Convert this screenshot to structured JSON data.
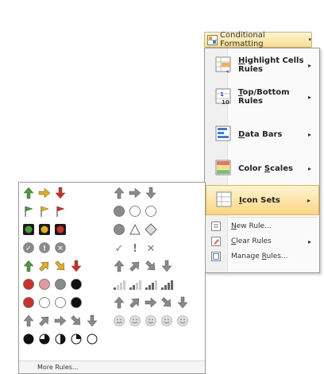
{
  "ribbon": {
    "label": "Conditional Formatting",
    "caret": "▾"
  },
  "menu": {
    "items": [
      {
        "label": "Highlight Cells Rules",
        "accel": "H",
        "rest": "ighlight Cells Rules",
        "icon": "highlight-cells-icon",
        "submenu": true
      },
      {
        "label": "Top/Bottom Rules",
        "accel": "T",
        "rest": "op/Bottom Rules",
        "icon": "top-bottom-icon",
        "submenu": true
      },
      {
        "label": "Data Bars",
        "accel": "D",
        "rest": "ata Bars",
        "icon": "data-bars-icon",
        "submenu": true
      },
      {
        "label": "Color Scales",
        "pre": "Color ",
        "accel": "S",
        "rest": "cales",
        "icon": "color-scales-icon",
        "submenu": true
      },
      {
        "label": "Icon Sets",
        "accel": "I",
        "rest": "con Sets",
        "icon": "icon-sets-icon",
        "submenu": true,
        "hover": true
      }
    ],
    "small_items": [
      {
        "label": "New Rule...",
        "accel": "N",
        "rest": "ew Rule...",
        "icon": "new-rule-icon",
        "submenu": false
      },
      {
        "label": "Clear Rules",
        "accel": "C",
        "rest": "lear Rules",
        "icon": "clear-rules-icon",
        "submenu": true
      },
      {
        "label": "Manage Rules...",
        "pre": "Manage ",
        "accel": "R",
        "rest": "ules...",
        "icon": "manage-rules-icon",
        "submenu": false
      }
    ]
  },
  "gallery": {
    "more_rules": "More Rules...",
    "left_sets": [
      [
        "arrow-up-green",
        "arrow-right-yellow",
        "arrow-down-red"
      ],
      [
        "flag-green",
        "flag-yellow",
        "flag-red"
      ],
      [
        "light-black-green",
        "light-black-yellow",
        "light-black-red"
      ],
      [
        "symbol-check-circle",
        "symbol-excl-circle",
        "symbol-x-circle"
      ],
      [
        "arrow-up-green",
        "arrow-ne-yellow",
        "arrow-se-yellow",
        "arrow-down-red"
      ],
      [
        "dot-red",
        "dot-pink",
        "dot-gray",
        "dot-black"
      ],
      [
        "dot-red",
        "dot-white",
        "dot-white",
        "dot-black"
      ],
      [
        "arrow-up-gray",
        "arrow-ne-gray",
        "arrow-right-gray",
        "arrow-se-gray",
        "arrow-down-gray"
      ],
      [
        "quarter-full",
        "quarter-3",
        "quarter-half",
        "quarter-1",
        "quarter-empty"
      ]
    ],
    "right_sets": [
      [
        "arrow-up-gray",
        "arrow-right-gray",
        "arrow-down-gray"
      ],
      [
        "dot-gray",
        "dot-white",
        "dot-white"
      ],
      [
        "dot-gray",
        "triangle-white",
        "diamond-white"
      ],
      [
        "check-gray",
        "excl-gray",
        "x-gray"
      ],
      [
        "arrow-up-gray",
        "arrow-ne-gray",
        "arrow-se-gray",
        "arrow-down-gray"
      ],
      [
        "bars-1",
        "bars-2",
        "bars-3",
        "bars-4"
      ],
      [
        "arrow-up-gray",
        "arrow-ne-gray",
        "arrow-right-gray",
        "arrow-se-gray",
        "arrow-down-gray"
      ],
      [
        "smile-1",
        "smile-2",
        "smile-3",
        "smile-4",
        "smile-5"
      ]
    ]
  },
  "colors": {
    "hover_fill": "#fcd683",
    "hover_border": "#d8b556",
    "menu_bg": "#fafafa"
  }
}
